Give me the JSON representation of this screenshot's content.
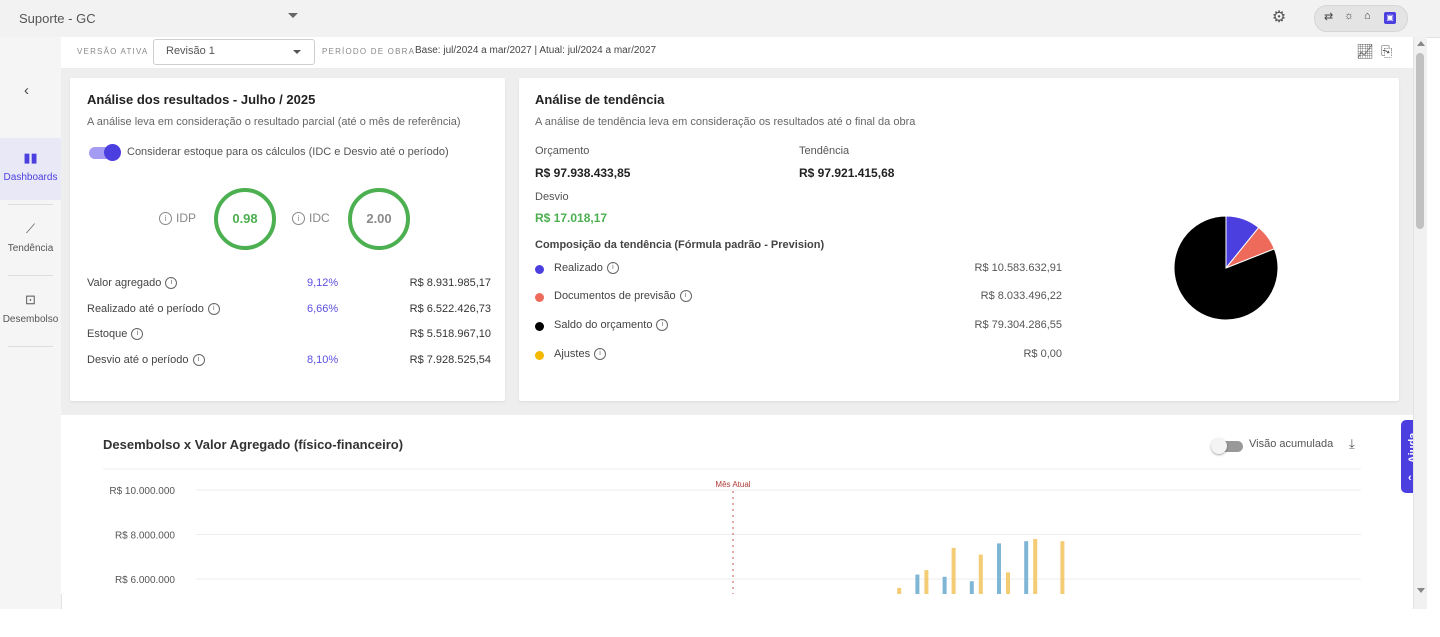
{
  "header": {
    "app_title": "Suporte - GC",
    "icons": [
      "gear-icon",
      "transfer-icon",
      "lightbulb-icon",
      "home-icon",
      "app-logo-icon"
    ]
  },
  "sidebar": {
    "items": [
      {
        "label": "Dashboards",
        "icon": "bar-chart-icon",
        "active": true
      },
      {
        "label": "Tendência",
        "icon": "trend-icon",
        "active": false
      },
      {
        "label": "Desembolso",
        "icon": "money-hand-icon",
        "active": false
      }
    ]
  },
  "subbar": {
    "version_label": "VERSÃO ATIVA",
    "version_value": "Revisão 1",
    "period_label": "PERÍODO DE OBRA",
    "period_value": "Base: jul/2024 a mar/2027 | Atual: jul/2024 a mar/2027"
  },
  "results": {
    "title": "Análise dos resultados - Julho / 2025",
    "subtitle": "A análise leva em consideração o resultado parcial (até o mês de referência)",
    "toggle_label": "Considerar estoque para os cálculos (IDC e Desvio até o período)",
    "idp_label": "IDP",
    "idp_value": "0.98",
    "idc_label": "IDC",
    "idc_value": "2.00",
    "rows": [
      {
        "name": "Valor agregado",
        "pct": "9,12%",
        "value": "R$ 8.931.985,17"
      },
      {
        "name": "Realizado até o período",
        "pct": "6,66%",
        "value": "R$ 6.522.426,73"
      },
      {
        "name": "Estoque",
        "pct": "",
        "value": "R$ 5.518.967,10"
      },
      {
        "name": "Desvio até o período",
        "pct": "8,10%",
        "value": "R$ 7.928.525,54"
      }
    ]
  },
  "trend": {
    "title": "Análise de tendência",
    "subtitle": "A análise de tendência leva em consideração os resultados até o final da obra",
    "budget_label": "Orçamento",
    "budget_value": "R$ 97.938.433,85",
    "trend_label": "Tendência",
    "trend_value": "R$ 97.921.415,68",
    "deviation_label": "Desvio",
    "deviation_value": "R$ 17.018,17",
    "composition_title": "Composição da tendência (Fórmula padrão - Prevision)",
    "composition": [
      {
        "name": "Realizado",
        "value": "R$ 10.583.632,91",
        "color": "#4b3fe0"
      },
      {
        "name": "Documentos de previsão",
        "value": "R$ 8.033.496,22",
        "color": "#ee6b5c"
      },
      {
        "name": "Saldo do orçamento",
        "value": "R$ 79.304.286,55",
        "color": "#000000"
      },
      {
        "name": "Ajustes",
        "value": "R$ 0,00",
        "color": "#f5b800"
      }
    ]
  },
  "chart_data": {
    "type": "bar",
    "title": "Desembolso x Valor Agregado (físico-financeiro)",
    "toggle_label": "Visão acumulada",
    "y_ticks": [
      "R$ 10.000.000",
      "R$ 8.000.000",
      "R$ 6.000.000"
    ],
    "ylim": [
      5500000,
      10500000
    ],
    "marker_label": "Mês Atual",
    "series": [
      {
        "color": "#7fb6d6",
        "values": [
          0,
          0,
          0,
          0,
          0,
          0,
          0,
          0,
          0,
          0,
          0,
          0,
          0,
          0,
          0,
          0,
          0,
          0,
          0,
          0,
          0,
          0,
          0,
          0,
          0,
          0,
          0,
          6200000,
          6100000,
          5900000,
          7600000,
          7700000
        ]
      },
      {
        "color": "#f4cc74",
        "values": [
          0,
          0,
          0,
          0,
          0,
          0,
          0,
          0,
          0,
          0,
          0,
          0,
          0,
          0,
          0,
          0,
          0,
          0,
          0,
          0,
          0,
          0,
          0,
          0,
          0,
          0,
          5600000,
          6400000,
          7400000,
          7100000,
          6300000,
          7800000,
          7700000
        ]
      }
    ]
  },
  "help": {
    "label": "Ajuda"
  }
}
